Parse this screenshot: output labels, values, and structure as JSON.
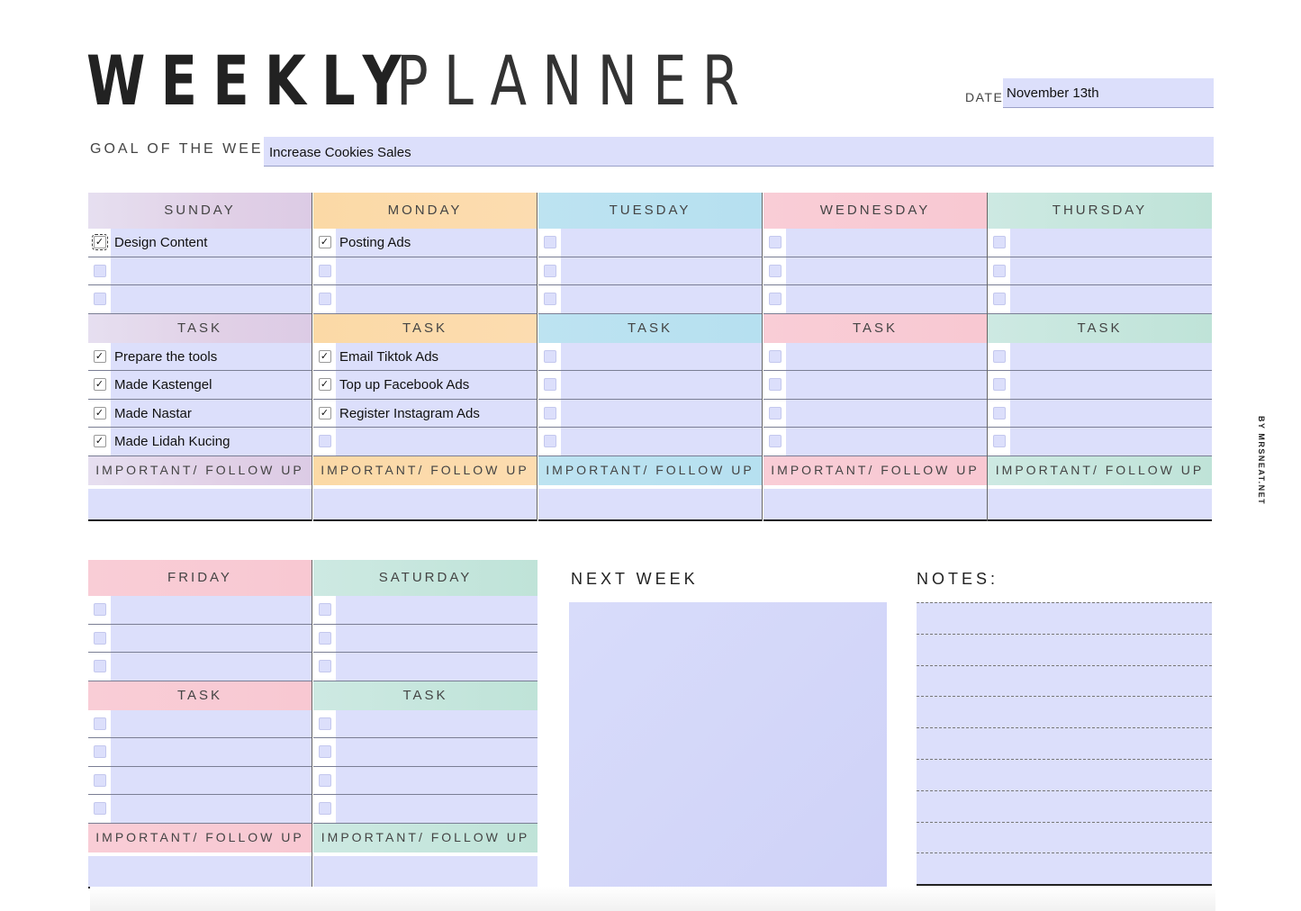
{
  "header": {
    "title_bold": "WEEKLY",
    "title_light": "PLANNER",
    "date_label": "DATE:",
    "date_value": "November 13th",
    "goal_label": "GOAL OF THE WEEK :",
    "goal_value": "Increase Cookies Sales"
  },
  "labels": {
    "task": "TASK",
    "important": "IMPORTANT/ FOLLOW UP",
    "next_week": "NEXT WEEK",
    "notes": "NOTES:",
    "credit": "BY MRSNEAT.NET"
  },
  "days": [
    {
      "name": "SUNDAY",
      "top_items": [
        {
          "text": "Design Content",
          "checked": true
        },
        {
          "text": "",
          "checked": false
        },
        {
          "text": "",
          "checked": false
        }
      ],
      "tasks": [
        {
          "text": "Prepare the tools",
          "checked": true
        },
        {
          "text": "Made Kastengel",
          "checked": true
        },
        {
          "text": "Made Nastar",
          "checked": true
        },
        {
          "text": "Made Lidah Kucing",
          "checked": true
        }
      ],
      "important": ""
    },
    {
      "name": "MONDAY",
      "top_items": [
        {
          "text": "Posting Ads",
          "checked": true
        },
        {
          "text": "",
          "checked": false
        },
        {
          "text": "",
          "checked": false
        }
      ],
      "tasks": [
        {
          "text": "Email Tiktok Ads",
          "checked": true
        },
        {
          "text": "Top up Facebook Ads",
          "checked": true
        },
        {
          "text": "Register Instagram Ads",
          "checked": true
        },
        {
          "text": "",
          "checked": false
        }
      ],
      "important": ""
    },
    {
      "name": "TUESDAY",
      "top_items": [
        {
          "text": "",
          "checked": false
        },
        {
          "text": "",
          "checked": false
        },
        {
          "text": "",
          "checked": false
        }
      ],
      "tasks": [
        {
          "text": "",
          "checked": false
        },
        {
          "text": "",
          "checked": false
        },
        {
          "text": "",
          "checked": false
        },
        {
          "text": "",
          "checked": false
        }
      ],
      "important": ""
    },
    {
      "name": "WEDNESDAY",
      "top_items": [
        {
          "text": "",
          "checked": false
        },
        {
          "text": "",
          "checked": false
        },
        {
          "text": "",
          "checked": false
        }
      ],
      "tasks": [
        {
          "text": "",
          "checked": false
        },
        {
          "text": "",
          "checked": false
        },
        {
          "text": "",
          "checked": false
        },
        {
          "text": "",
          "checked": false
        }
      ],
      "important": ""
    },
    {
      "name": "THURSDAY",
      "top_items": [
        {
          "text": "",
          "checked": false
        },
        {
          "text": "",
          "checked": false
        },
        {
          "text": "",
          "checked": false
        }
      ],
      "tasks": [
        {
          "text": "",
          "checked": false
        },
        {
          "text": "",
          "checked": false
        },
        {
          "text": "",
          "checked": false
        },
        {
          "text": "",
          "checked": false
        }
      ],
      "important": ""
    },
    {
      "name": "FRIDAY",
      "top_items": [
        {
          "text": "",
          "checked": false
        },
        {
          "text": "",
          "checked": false
        },
        {
          "text": "",
          "checked": false
        }
      ],
      "tasks": [
        {
          "text": "",
          "checked": false
        },
        {
          "text": "",
          "checked": false
        },
        {
          "text": "",
          "checked": false
        },
        {
          "text": "",
          "checked": false
        }
      ],
      "important": ""
    },
    {
      "name": "SATURDAY",
      "top_items": [
        {
          "text": "",
          "checked": false
        },
        {
          "text": "",
          "checked": false
        },
        {
          "text": "",
          "checked": false
        }
      ],
      "tasks": [
        {
          "text": "",
          "checked": false
        },
        {
          "text": "",
          "checked": false
        },
        {
          "text": "",
          "checked": false
        },
        {
          "text": "",
          "checked": false
        }
      ],
      "important": ""
    }
  ],
  "notes": [
    "",
    "",
    "",
    "",
    "",
    "",
    "",
    "",
    ""
  ],
  "next_week": "",
  "colors": {
    "field_fill": "#dcdffb",
    "sunday": "#e1d0e6",
    "monday": "#fcdcb0",
    "tuesday": "#b6e0f0",
    "wednesday": "#f8c8d2",
    "thursday": "#bfe3d8",
    "friday": "#f8c8d2",
    "saturday": "#cde9e2"
  }
}
